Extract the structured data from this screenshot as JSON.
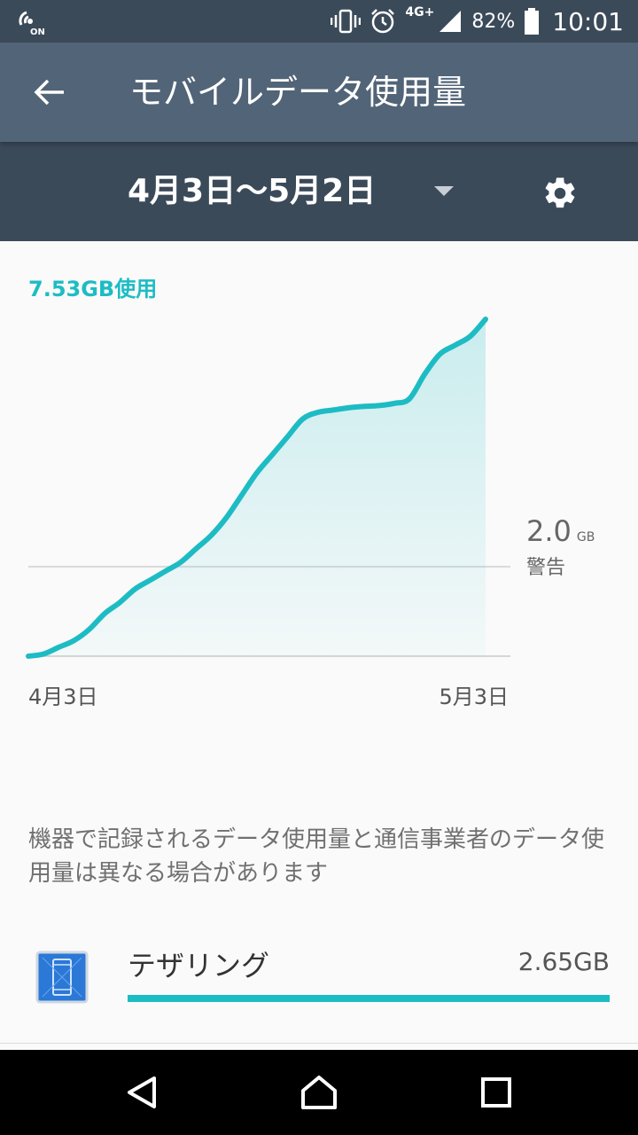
{
  "status_bar": {
    "left_icon": "nfc-on-icon",
    "left_text": "ON",
    "network": "4G+",
    "battery_percent": "82%",
    "time": "10:01",
    "icons": [
      "vibrate-icon",
      "alarm-icon",
      "signal-icon",
      "battery-icon"
    ]
  },
  "header": {
    "title": "モバイルデータ使用量",
    "back_icon": "arrow-back-icon"
  },
  "period": {
    "label": "4月3日〜5月2日",
    "dropdown_icon": "chevron-down-icon",
    "settings_icon": "gear-icon"
  },
  "usage": {
    "total": "7.53GB使用",
    "warning_value": "2.0",
    "warning_unit": "GB",
    "warning_label": "警告"
  },
  "chart_data": {
    "type": "area",
    "x": [
      0,
      1,
      2,
      3,
      4,
      5,
      6,
      7,
      8,
      9,
      10,
      11,
      12,
      13,
      14,
      15,
      16,
      17,
      18,
      19,
      20,
      21,
      22,
      23,
      24,
      25,
      26,
      27,
      28,
      29,
      30
    ],
    "y": [
      0.0,
      0.05,
      0.2,
      0.35,
      0.6,
      0.95,
      1.2,
      1.5,
      1.7,
      1.9,
      2.1,
      2.4,
      2.7,
      3.1,
      3.6,
      4.1,
      4.5,
      4.9,
      5.3,
      5.45,
      5.5,
      5.55,
      5.58,
      5.6,
      5.65,
      5.75,
      6.3,
      6.75,
      6.95,
      7.15,
      7.53
    ],
    "x_tick_labels": [
      "4月3日",
      "5月3日"
    ],
    "warning_level": 2.0,
    "ylim": [
      0,
      7.53
    ],
    "grid": false,
    "colors": {
      "line": "#1dbcc4",
      "fill": "#1dbcc4"
    }
  },
  "notice": "機器で記録されるデータ使用量と通信事業者のデータ使用量は異なる場合があります",
  "apps": [
    {
      "name": "テザリング",
      "size": "2.65GB",
      "fraction": 1.0,
      "icon": "tethering-icon"
    }
  ],
  "nav": {
    "back_icon": "nav-back-icon",
    "home_icon": "nav-home-icon",
    "recents_icon": "nav-recents-icon"
  }
}
